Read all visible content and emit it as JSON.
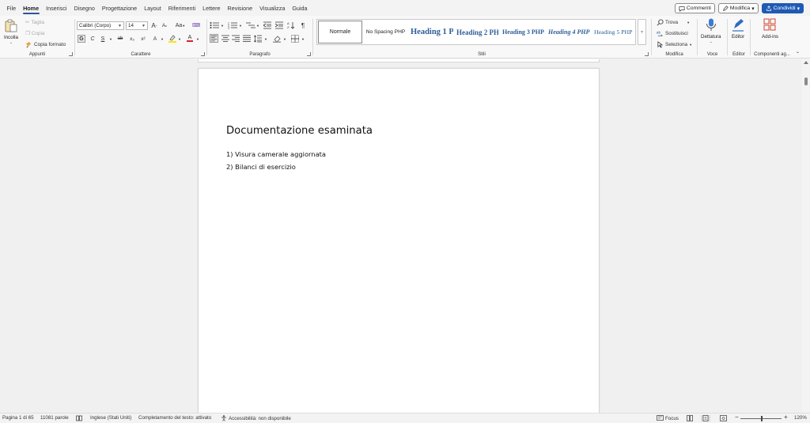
{
  "tabs": [
    "File",
    "Home",
    "Inserisci",
    "Disegno",
    "Progettazione",
    "Layout",
    "Riferimenti",
    "Lettere",
    "Revisione",
    "Visualizza",
    "Guida"
  ],
  "active_tab": "Home",
  "top_buttons": {
    "comments": "Commenti",
    "edit": "Modifica",
    "share": "Condividi"
  },
  "clipboard": {
    "paste": "Incolla",
    "cut": "Taglia",
    "copy": "Copia",
    "format_painter": "Copia formato",
    "label": "Appunti"
  },
  "font": {
    "family": "Calibri (Corpo)",
    "size": "14",
    "grow": "A",
    "shrink": "A",
    "case": "Aa",
    "bold": "G",
    "italic": "C",
    "underline": "S",
    "strike": "ab",
    "subscript": "x₂",
    "superscript": "x²",
    "font_color": "A",
    "label": "Carattere"
  },
  "paragraph": {
    "label": "Paragrafo",
    "pilcrow": "¶"
  },
  "styles": {
    "label": "Stili",
    "items": [
      "Normale",
      "No Spacing PHP",
      "Heading 1 PHP",
      "Heading 2 PHP",
      "Heading 3 PHP",
      "Heading 4 PHP",
      "Heading 5 PHP"
    ]
  },
  "editing": {
    "find": "Trova",
    "replace": "Sostituisci",
    "select": "Seleziona",
    "label": "Modifica"
  },
  "voice": {
    "dictate": "Dettatura",
    "label": "Voce"
  },
  "editor": {
    "button": "Editor",
    "label": "Editor"
  },
  "addins": {
    "button": "Add-ins",
    "label": "Componenti ag..."
  },
  "document": {
    "heading": "Documentazione esaminata",
    "lines": [
      "1) Visura camerale aggiornata",
      "2) Bilanci di esercizio"
    ]
  },
  "status": {
    "page": "Pagina 1 di 65",
    "words": "11081 parole",
    "language": "Inglese (Stati Uniti)",
    "autocomplete": "Completamento del testo: attivato",
    "accessibility": "Accessibilità: non disponibile",
    "focus": "Focus",
    "zoom": "120%"
  },
  "colors": {
    "accent": "#1e5ab4",
    "heading_style": "#2e5e9a",
    "highlight": "#ffe600",
    "font_color": "#e02020"
  }
}
